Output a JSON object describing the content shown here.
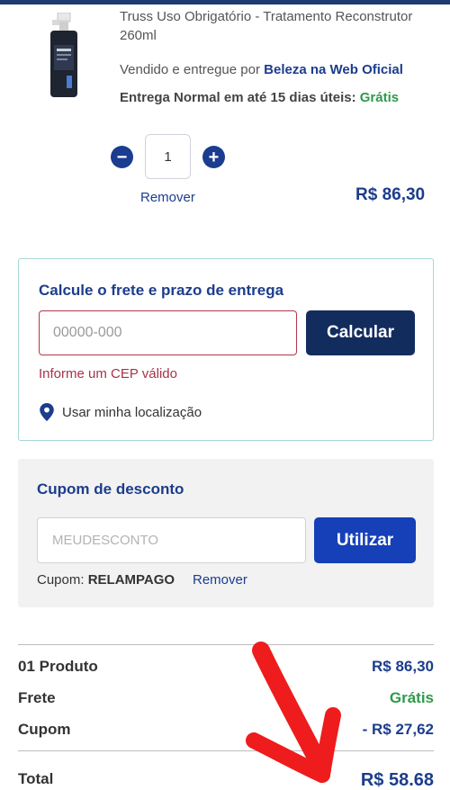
{
  "product": {
    "name": "Truss Uso Obrigatório - Tratamento Reconstrutor 260ml",
    "seller_prefix": "Vendido e entregue por ",
    "seller_name": "Beleza na Web Oficial",
    "delivery_prefix": "Entrega Normal em até 15 dias úteis: ",
    "delivery_free": "Grátis",
    "quantity": "1",
    "remove_label": "Remover",
    "price": "R$ 86,30"
  },
  "shipping": {
    "title": "Calcule o frete e prazo de entrega",
    "cep_placeholder": "00000-000",
    "calc_button": "Calcular",
    "error": "Informe um CEP válido",
    "location_label": "Usar minha localização"
  },
  "coupon": {
    "title": "Cupom de desconto",
    "placeholder": "MEUDESCONTO",
    "use_button": "Utilizar",
    "applied_prefix": "Cupom: ",
    "applied_code": "RELAMPAGO",
    "remove_label": "Remover"
  },
  "summary": {
    "products_label": "01 Produto",
    "products_value": "R$ 86,30",
    "shipping_label": "Frete",
    "shipping_value": "Grátis",
    "coupon_label": "Cupom",
    "coupon_value": "- R$ 27,62",
    "total_label": "Total",
    "total_value": "R$ 58.68"
  },
  "colors": {
    "brand_blue": "#1c3d8c",
    "dark_navy": "#132c5e",
    "button_blue": "#1640b8",
    "success_green": "#2e9a4a",
    "error_red": "#a8324a",
    "annotation_red": "#ee1c1c"
  }
}
